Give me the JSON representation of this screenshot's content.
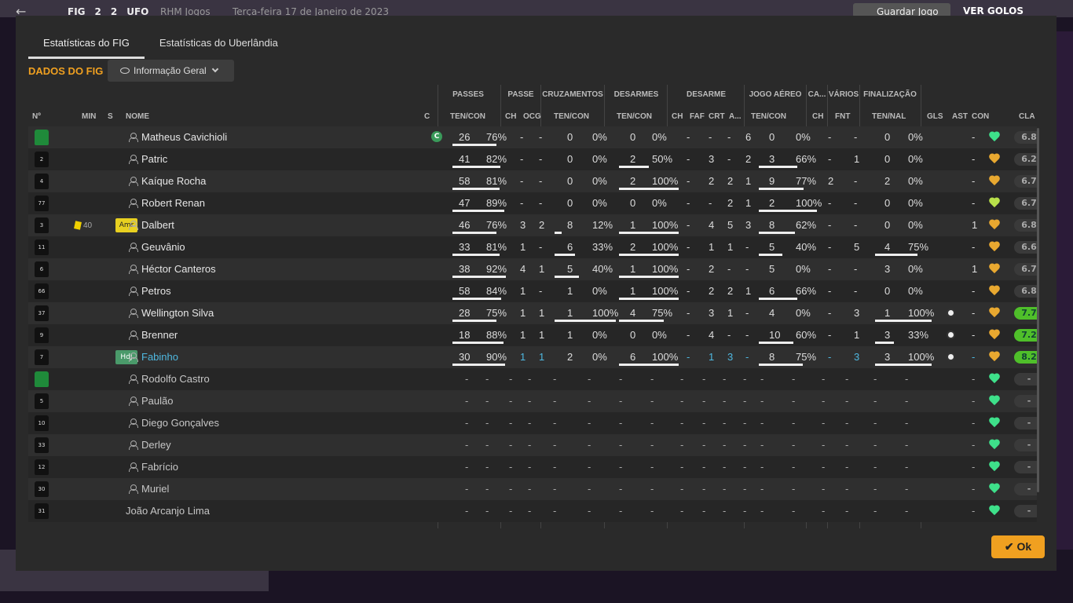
{
  "background": {
    "back_icon": "←",
    "score": [
      "FIG",
      "2",
      "2",
      "UFO"
    ],
    "team_label": "RHM Jogos",
    "date": "Terça-feira 17 de Janeiro de 2023",
    "save_label": "Guardar Jogo",
    "goals_label": "VER GOLOS"
  },
  "tabs": [
    "Estatísticas do FIG",
    "Estatísticas do Uberlândia"
  ],
  "section_title": "DADOS DO FIG",
  "dropdown_value": "Informação Geral",
  "group_headers": [
    "PASSES",
    "PASSE",
    "CRUZAMENTOS",
    "DESARMES",
    "DESARME",
    "JOGO AÉREO",
    "CA...",
    "VÁRIOS",
    "FINALIZAÇÃO"
  ],
  "column_headers": [
    "Nº",
    "MIN",
    "S",
    "NOME",
    "C",
    "TEN/CON",
    "CH",
    "OCG",
    "TEN/CON",
    "TEN/CON",
    "CH",
    "FAF",
    "CRT",
    "A...",
    "TEN/CON",
    "CH",
    "FNT",
    "TEN/NAL",
    "GLS",
    "AST",
    "CON",
    "CLA"
  ],
  "players": [
    {
      "no": "",
      "gk": true,
      "min": "",
      "s": "",
      "name": "Matheus Cavichioli",
      "cap": "C",
      "p1": "26",
      "p2": "76%",
      "pb": 76,
      "pch": "-",
      "pocg": "-",
      "cr1": "0",
      "cr2": "0%",
      "crb": 0,
      "d1": "0",
      "d2": "0%",
      "db": 0,
      "dch": "-",
      "dfaf": "-",
      "dcrt": "-",
      "da": "6",
      "ja1": "0",
      "ja2": "0%",
      "jab": 0,
      "ca": "-",
      "fnt": "-",
      "f1": "0",
      "f2": "0%",
      "fb": 0,
      "gls": "",
      "ast": "-",
      "con": "g",
      "cla": "6.8"
    },
    {
      "no": "2",
      "min": "",
      "s": "",
      "name": "Patric",
      "p1": "41",
      "p2": "82%",
      "pb": 82,
      "pch": "-",
      "pocg": "-",
      "cr1": "0",
      "cr2": "0%",
      "crb": 0,
      "d1": "2",
      "d2": "50%",
      "db": 50,
      "dch": "-",
      "dfaf": "3",
      "dcrt": "-",
      "da": "2",
      "ja1": "3",
      "ja2": "66%",
      "jab": 66,
      "ca": "-",
      "fnt": "1",
      "f1": "0",
      "f2": "0%",
      "fb": 0,
      "gls": "",
      "ast": "-",
      "con": "o",
      "cla": "6.2"
    },
    {
      "no": "4",
      "min": "",
      "s": "",
      "name": "Kaíque Rocha",
      "p1": "58",
      "p2": "81%",
      "pb": 81,
      "pch": "-",
      "pocg": "-",
      "cr1": "0",
      "cr2": "0%",
      "crb": 0,
      "d1": "2",
      "d2": "100%",
      "db": 100,
      "dch": "-",
      "dfaf": "2",
      "dcrt": "2",
      "da": "1",
      "ja1": "9",
      "ja2": "77%",
      "jab": 77,
      "ca": "2",
      "fnt": "-",
      "f1": "2",
      "f2": "0%",
      "fb": 0,
      "gls": "",
      "ast": "-",
      "con": "o",
      "cla": "6.7"
    },
    {
      "no": "77",
      "min": "",
      "s": "",
      "name": "Robert Renan",
      "p1": "47",
      "p2": "89%",
      "pb": 89,
      "pch": "-",
      "pocg": "-",
      "cr1": "0",
      "cr2": "0%",
      "crb": 0,
      "d1": "0",
      "d2": "0%",
      "db": 0,
      "dch": "-",
      "dfaf": "-",
      "dcrt": "2",
      "da": "1",
      "ja1": "2",
      "ja2": "100%",
      "jab": 100,
      "ca": "-",
      "fnt": "-",
      "f1": "0",
      "f2": "0%",
      "fb": 0,
      "gls": "",
      "ast": "-",
      "con": "yg",
      "cla": "6.7"
    },
    {
      "no": "3",
      "min": "40",
      "s": "Amr",
      "yc": true,
      "name": "Dalbert",
      "p1": "46",
      "p2": "76%",
      "pb": 76,
      "pch": "3",
      "pocg": "2",
      "cr1": "8",
      "cr2": "12%",
      "crb": 12,
      "d1": "1",
      "d2": "100%",
      "db": 100,
      "dch": "-",
      "dfaf": "4",
      "dcrt": "5",
      "da": "3",
      "ja1": "8",
      "ja2": "62%",
      "jab": 62,
      "ca": "-",
      "fnt": "-",
      "f1": "0",
      "f2": "0%",
      "fb": 0,
      "gls": "",
      "ast": "1",
      "con": "o",
      "cla": "6.8"
    },
    {
      "no": "11",
      "min": "",
      "s": "",
      "name": "Geuvânio",
      "p1": "33",
      "p2": "81%",
      "pb": 81,
      "pch": "1",
      "pocg": "-",
      "cr1": "6",
      "cr2": "33%",
      "crb": 33,
      "d1": "2",
      "d2": "100%",
      "db": 100,
      "dch": "-",
      "dfaf": "1",
      "dcrt": "1",
      "da": "-",
      "ja1": "5",
      "ja2": "40%",
      "jab": 40,
      "ca": "-",
      "fnt": "5",
      "f1": "4",
      "f2": "75%",
      "fb": 75,
      "gls": "",
      "ast": "-",
      "con": "o",
      "cla": "6.6"
    },
    {
      "no": "6",
      "min": "",
      "s": "",
      "name": "Héctor Canteros",
      "p1": "38",
      "p2": "92%",
      "pb": 92,
      "pch": "4",
      "pocg": "1",
      "cr1": "5",
      "cr2": "40%",
      "crb": 40,
      "d1": "1",
      "d2": "100%",
      "db": 100,
      "dch": "-",
      "dfaf": "2",
      "dcrt": "-",
      "da": "-",
      "ja1": "5",
      "ja2": "0%",
      "jab": 0,
      "ca": "-",
      "fnt": "-",
      "f1": "3",
      "f2": "0%",
      "fb": 0,
      "gls": "",
      "ast": "1",
      "con": "o",
      "cla": "6.7"
    },
    {
      "no": "66",
      "min": "",
      "s": "",
      "name": "Petros",
      "p1": "58",
      "p2": "84%",
      "pb": 84,
      "pch": "1",
      "pocg": "-",
      "cr1": "1",
      "cr2": "0%",
      "crb": 0,
      "d1": "1",
      "d2": "100%",
      "db": 100,
      "dch": "-",
      "dfaf": "2",
      "dcrt": "2",
      "da": "1",
      "ja1": "6",
      "ja2": "66%",
      "jab": 66,
      "ca": "-",
      "fnt": "-",
      "f1": "0",
      "f2": "0%",
      "fb": 0,
      "gls": "",
      "ast": "-",
      "con": "o",
      "cla": "6.8"
    },
    {
      "no": "37",
      "min": "",
      "s": "",
      "name": "Wellington Silva",
      "p1": "28",
      "p2": "75%",
      "pb": 75,
      "pch": "1",
      "pocg": "1",
      "cr1": "1",
      "cr2": "100%",
      "crb": 100,
      "d1": "4",
      "d2": "75%",
      "db": 75,
      "dch": "-",
      "dfaf": "3",
      "dcrt": "1",
      "da": "-",
      "ja1": "4",
      "ja2": "0%",
      "jab": 0,
      "ca": "-",
      "fnt": "3",
      "f1": "1",
      "f2": "100%",
      "fb": 100,
      "gls": "ball",
      "ast": "-",
      "con": "o",
      "cla": "7.7",
      "hi": true
    },
    {
      "no": "9",
      "min": "",
      "s": "",
      "name": "Brenner",
      "p1": "18",
      "p2": "88%",
      "pb": 88,
      "pch": "1",
      "pocg": "1",
      "cr1": "1",
      "cr2": "0%",
      "crb": 0,
      "d1": "0",
      "d2": "0%",
      "db": 0,
      "dch": "-",
      "dfaf": "4",
      "dcrt": "-",
      "da": "-",
      "ja1": "10",
      "ja2": "60%",
      "jab": 60,
      "ca": "-",
      "fnt": "1",
      "f1": "3",
      "f2": "33%",
      "fb": 33,
      "gls": "ball",
      "ast": "-",
      "con": "o",
      "cla": "7.2",
      "hi": true
    },
    {
      "no": "7",
      "min": "",
      "s": "HdJ",
      "name": "Fabinho",
      "hl": true,
      "p1": "30",
      "p2": "90%",
      "pb": 90,
      "pch": "1",
      "pocg": "1",
      "cr1": "2",
      "cr2": "0%",
      "crb": 0,
      "d1": "6",
      "d2": "100%",
      "db": 100,
      "dch": "-",
      "dfaf": "1",
      "dcrt": "3",
      "da": "-",
      "ja1": "8",
      "ja2": "75%",
      "jab": 75,
      "ca": "-",
      "fnt": "3",
      "f1": "3",
      "f2": "100%",
      "fb": 100,
      "gls": "ball",
      "ast": "-",
      "con": "o",
      "cla": "8.2",
      "hi": true
    },
    {
      "no": "",
      "gk": true,
      "min": "",
      "s": "",
      "name": "Rodolfo Castro",
      "sub": true,
      "con": "g",
      "cla": "-"
    },
    {
      "no": "5",
      "min": "",
      "s": "",
      "name": "Paulão",
      "sub": true,
      "con": "g",
      "cla": "-"
    },
    {
      "no": "10",
      "min": "",
      "s": "",
      "name": "Diego Gonçalves",
      "sub": true,
      "con": "g",
      "cla": "-"
    },
    {
      "no": "33",
      "min": "",
      "s": "",
      "name": "Derley",
      "sub": true,
      "con": "g",
      "cla": "-"
    },
    {
      "no": "12",
      "min": "",
      "s": "",
      "name": "Fabrício",
      "sub": true,
      "con": "g",
      "cla": "-"
    },
    {
      "no": "30",
      "min": "",
      "s": "",
      "name": "Muriel",
      "sub": true,
      "con": "g",
      "cla": "-"
    },
    {
      "no": "31",
      "min": "",
      "s": "",
      "name": "João Arcanjo Lima",
      "sub": true,
      "noperson": true,
      "con": "g",
      "cla": "-"
    }
  ],
  "ok_label": "Ok",
  "icons": {
    "eye": "eye-icon",
    "chevron": "chevron-down-icon",
    "person": "person-icon",
    "heart": "condition-heart-icon",
    "ball": "goal-ball-icon",
    "check": "check-icon"
  },
  "colors": {
    "accent": "#f0a020",
    "highlight": "#4fb8e0",
    "good": "#3ee08a",
    "rating_high": "#4fbf2a"
  }
}
